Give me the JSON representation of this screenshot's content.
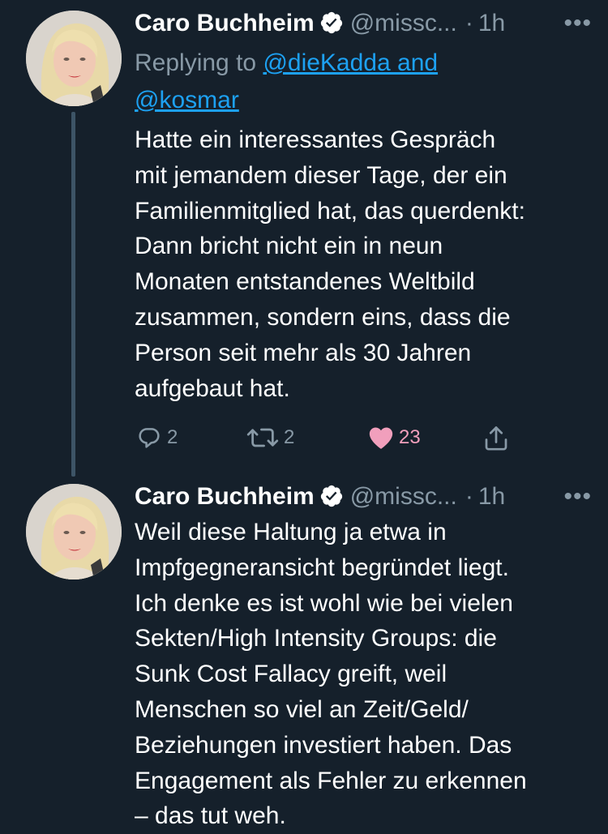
{
  "tweets": [
    {
      "author_name": "Caro Buchheim",
      "handle": "@missc...",
      "separator": "·",
      "time": "1h",
      "more_label": "•••",
      "replying_prefix": "Replying to ",
      "replying_mentions_line1": "@dieKadda and",
      "replying_mentions_line2": "@kosmar",
      "text": "Hatte ein interessantes Gespräch\nmit jemandem dieser Tage, der ein\nFamilienmitglied hat, das querdenkt:\nDann bricht nicht ein in neun\nMonaten entstandenes Weltbild\nzusammen, sondern eins, dass die\nPerson seit mehr als 30 Jahren\naufgebaut hat.",
      "reply_count": "2",
      "retweet_count": "2",
      "like_count": "23"
    },
    {
      "author_name": "Caro Buchheim",
      "handle": "@missc...",
      "separator": "·",
      "time": "1h",
      "more_label": "•••",
      "text": "Weil diese Haltung ja etwa in\nImpfgegneransicht begründet liegt.\nIch denke es ist wohl wie bei vielen\nSekten/High Intensity Groups: die\nSunk Cost Fallacy greift, weil\nMenschen so viel an Zeit/Geld/\nBeziehungen investiert haben. Das\nEngagement als Fehler zu erkennen\n– das tut weh."
    }
  ],
  "colors": {
    "background": "#15202b",
    "secondary_text": "#8899a6",
    "link": "#1da1f2",
    "like": "#e0245e",
    "thread_line": "#3d5466"
  }
}
